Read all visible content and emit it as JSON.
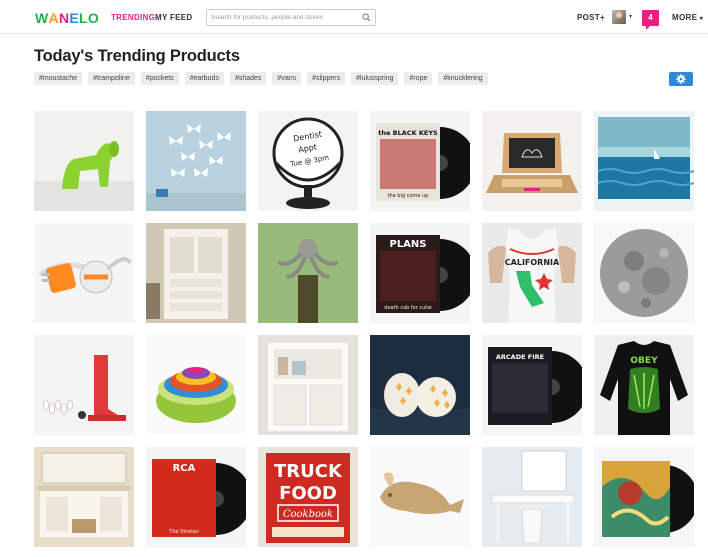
{
  "header": {
    "logo_letters": [
      {
        "char": "W",
        "color": "#23b14d"
      },
      {
        "char": "A",
        "color": "#f9a11b"
      },
      {
        "char": "N",
        "color": "#e8217e"
      },
      {
        "char": "E",
        "color": "#2d8ad8"
      },
      {
        "char": "L",
        "color": "#23b14d"
      },
      {
        "char": "O",
        "color": "#23b14d"
      }
    ],
    "nav": {
      "trending": "TRENDING",
      "trending_color": "#e8217e",
      "my_feed": "MY FEED"
    },
    "search": {
      "placeholder": "Search for products, people and stores",
      "icon": "magnifier-icon"
    },
    "post": "POST+",
    "notification_count": "4",
    "notification_color": "#e8217e",
    "more": "MORE"
  },
  "page": {
    "title": "Today's Trending Products",
    "tags": [
      "#moustache",
      "#trampoline",
      "#pockets",
      "#earbuds",
      "#shades",
      "#vans",
      "#slippers",
      "#lulusspring",
      "#rope",
      "#knucklering"
    ],
    "settings_icon": "gear-icon",
    "accent_color": "#2d8ad8"
  },
  "products": {
    "rows": [
      [
        {
          "kind": "green-dog-stand"
        },
        {
          "kind": "butterfly-wall-decor"
        },
        {
          "kind": "dentist-appt-globe",
          "lines": [
            "Dentist",
            "Appt",
            "Tue @ 3pm"
          ]
        },
        {
          "kind": "record",
          "sleeve_text": "the BLACK KEYS",
          "sub_text": "the big come up"
        },
        {
          "kind": "toy-laptop"
        },
        {
          "kind": "ocean-bedding"
        }
      ],
      [
        {
          "kind": "cord-organizer"
        },
        {
          "kind": "white-cabinet"
        },
        {
          "kind": "octopus-bottle-opener"
        },
        {
          "kind": "record",
          "sleeve_text": "PLANS",
          "sub_text": "death cab for cutie"
        },
        {
          "kind": "california-tank",
          "text": "CALIFORNIA"
        },
        {
          "kind": "moon-print"
        }
      ],
      [
        {
          "kind": "bowling-toy"
        },
        {
          "kind": "nesting-bowls"
        },
        {
          "kind": "bookcase-cabinet"
        },
        {
          "kind": "lantern-candles"
        },
        {
          "kind": "record",
          "sleeve_text": "ARCADE FIRE",
          "sub_text": ""
        },
        {
          "kind": "sweatshirt",
          "text": "OBEY"
        }
      ],
      [
        {
          "kind": "bathroom-vanity"
        },
        {
          "kind": "record",
          "sleeve_text": "RCA",
          "sub_text": "The Strokes"
        },
        {
          "kind": "truck-food-cookbook",
          "lines": [
            "TRUCK",
            "FOOD",
            "Cookbook"
          ]
        },
        {
          "kind": "whale-cutting-board"
        },
        {
          "kind": "white-desk"
        },
        {
          "kind": "psychedelic-record"
        }
      ]
    ]
  }
}
